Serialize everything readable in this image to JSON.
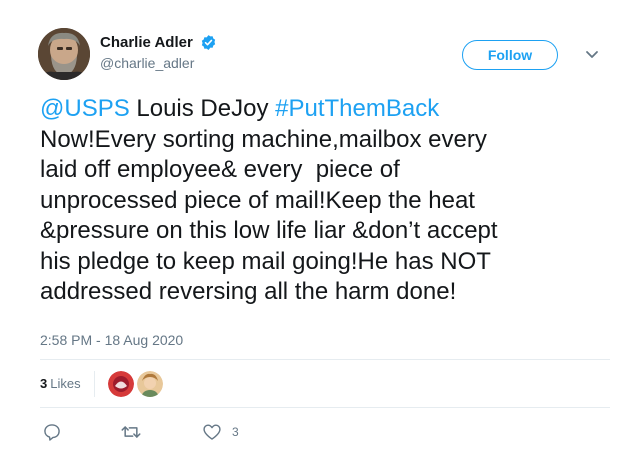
{
  "author": {
    "display_name": "Charlie Adler",
    "handle": "@charlie_adler",
    "verified": true
  },
  "header": {
    "follow_label": "Follow"
  },
  "tweet": {
    "mention": "@USPS",
    "text_after_mention": " Louis DeJoy ",
    "hashtag": "#PutThemBack",
    "body": "\nNow!Every sorting machine,mailbox every\nlaid off employee& every  piece of\nunprocessed piece of mail!Keep the heat\n&pressure on this low life liar &don’t accept\nhis pledge to keep mail going!He has NOT\naddressed reversing all the harm done!",
    "timestamp": "2:58 PM - 18 Aug 2020"
  },
  "stats": {
    "likes_count": "3",
    "likes_label": "Likes"
  },
  "actions": {
    "reply_icon": "reply-icon",
    "retweet_icon": "retweet-icon",
    "like_icon": "heart-icon",
    "like_count": "3"
  },
  "colors": {
    "accent": "#1da1f2",
    "text": "#14171a",
    "muted": "#657786",
    "divider": "#e6ecf0"
  }
}
